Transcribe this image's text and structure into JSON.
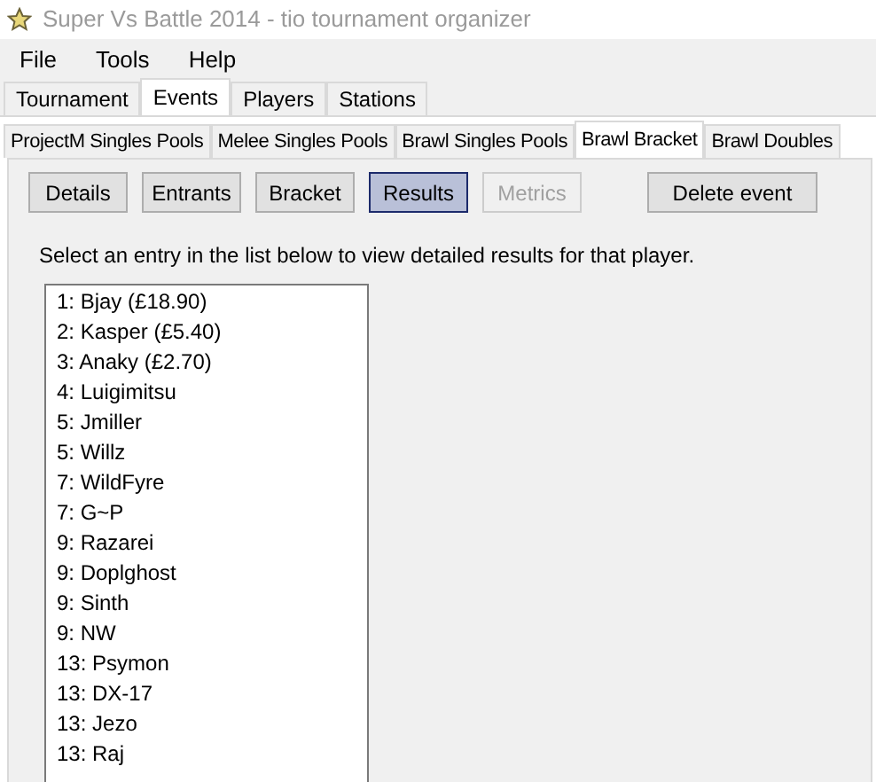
{
  "window": {
    "title": "Super Vs Battle 2014 - tio tournament organizer"
  },
  "menu": [
    "File",
    "Tools",
    "Help"
  ],
  "tabs": [
    {
      "label": "Tournament",
      "selected": false
    },
    {
      "label": "Events",
      "selected": true
    },
    {
      "label": "Players",
      "selected": false
    },
    {
      "label": "Stations",
      "selected": false
    }
  ],
  "event_tabs": [
    {
      "label": "ProjectM Singles Pools",
      "selected": false
    },
    {
      "label": "Melee Singles Pools",
      "selected": false
    },
    {
      "label": "Brawl Singles Pools",
      "selected": false
    },
    {
      "label": "Brawl Bracket",
      "selected": true
    },
    {
      "label": "Brawl Doubles",
      "selected": false
    }
  ],
  "buttons": [
    {
      "label": "Details",
      "selected": false,
      "disabled": false
    },
    {
      "label": "Entrants",
      "selected": false,
      "disabled": false
    },
    {
      "label": "Bracket",
      "selected": false,
      "disabled": false
    },
    {
      "label": "Results",
      "selected": true,
      "disabled": false
    },
    {
      "label": "Metrics",
      "selected": false,
      "disabled": true
    }
  ],
  "delete_button": "Delete event",
  "instruction": "Select an entry in the list below to view detailed results for that player.",
  "results": [
    "1: Bjay (£18.90)",
    "2: Kasper (£5.40)",
    "3: Anaky (£2.70)",
    "4: Luigimitsu",
    "5: Jmiller",
    "5: Willz",
    "7: WildFyre",
    "7: G~P",
    "9: Razarei",
    "9: Doplghost",
    "9: Sinth",
    "9: NW",
    "13: Psymon",
    "13: DX-17",
    "13: Jezo",
    "13: Raj"
  ]
}
